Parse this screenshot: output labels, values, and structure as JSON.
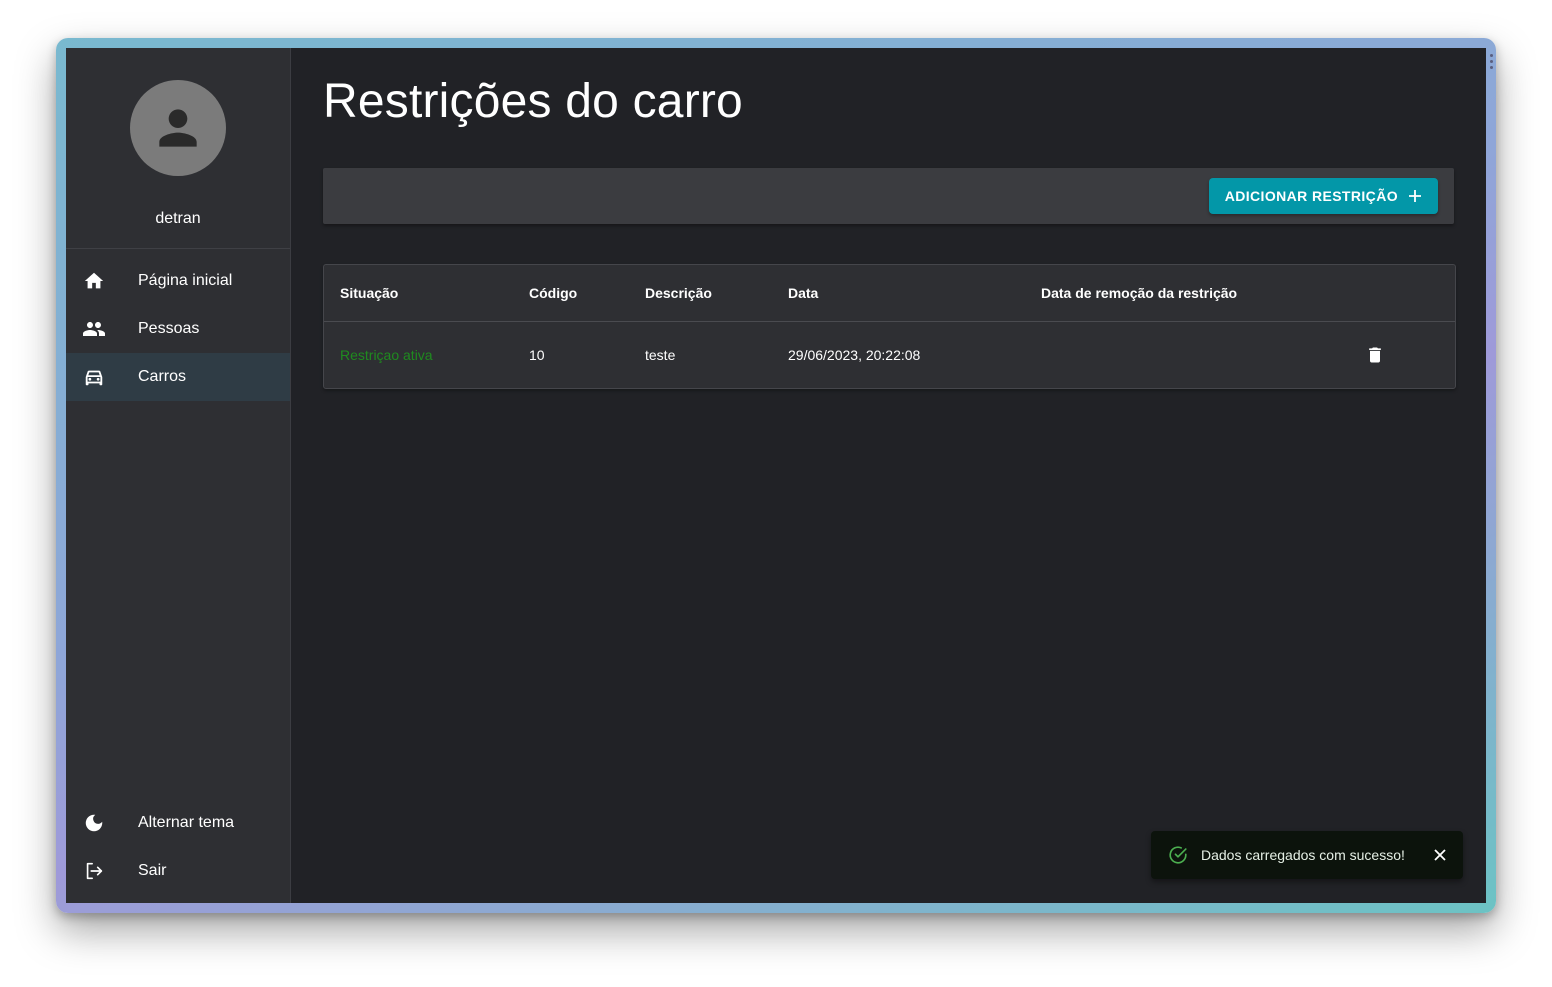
{
  "sidebar": {
    "username": "detran",
    "items": [
      {
        "label": "Página inicial",
        "icon": "home-icon"
      },
      {
        "label": "Pessoas",
        "icon": "people-icon"
      },
      {
        "label": "Carros",
        "icon": "car-icon",
        "active": true
      }
    ],
    "bottom": [
      {
        "label": "Alternar tema",
        "icon": "moon-icon"
      },
      {
        "label": "Sair",
        "icon": "logout-icon"
      }
    ]
  },
  "main": {
    "title": "Restrições do carro",
    "add_button_label": "ADICIONAR RESTRIÇÃO",
    "table": {
      "headers": [
        "Situação",
        "Código",
        "Descrição",
        "Data",
        "Data de remoção da restrição",
        ""
      ],
      "rows": [
        {
          "status": "Restriçao ativa",
          "code": "10",
          "description": "teste",
          "date": "29/06/2023, 20:22:08",
          "removal_date": ""
        }
      ]
    }
  },
  "snackbar": {
    "message": "Dados carregados com sucesso!",
    "icon": "check-circle-icon"
  },
  "colors": {
    "accent": "#0397a8",
    "status_active": "#1f8a1f",
    "background": "#212226",
    "sidebar": "#2e2f33"
  }
}
